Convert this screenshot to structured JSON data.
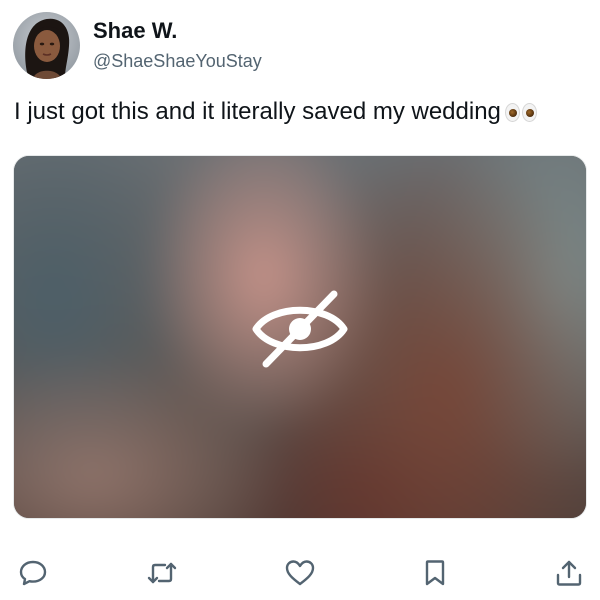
{
  "user": {
    "display_name": "Shae W.",
    "handle": "@ShaeShaeYouStay"
  },
  "tweet": {
    "text": "I just got this and it literally saved my wedding",
    "emoji": "eyes-emoji"
  },
  "media": {
    "state": "sensitive content hidden",
    "icon": "eye-slash-icon"
  },
  "actions": [
    {
      "name": "reply",
      "icon": "speech-bubble-icon"
    },
    {
      "name": "retweet",
      "icon": "retweet-arrows-icon"
    },
    {
      "name": "like",
      "icon": "heart-icon"
    },
    {
      "name": "bookmark",
      "icon": "bookmark-icon"
    },
    {
      "name": "share",
      "icon": "share-upload-icon"
    }
  ],
  "colors": {
    "text_primary": "#0f1419",
    "text_secondary": "#536471",
    "icon_gray": "#536471",
    "background": "#ffffff"
  }
}
